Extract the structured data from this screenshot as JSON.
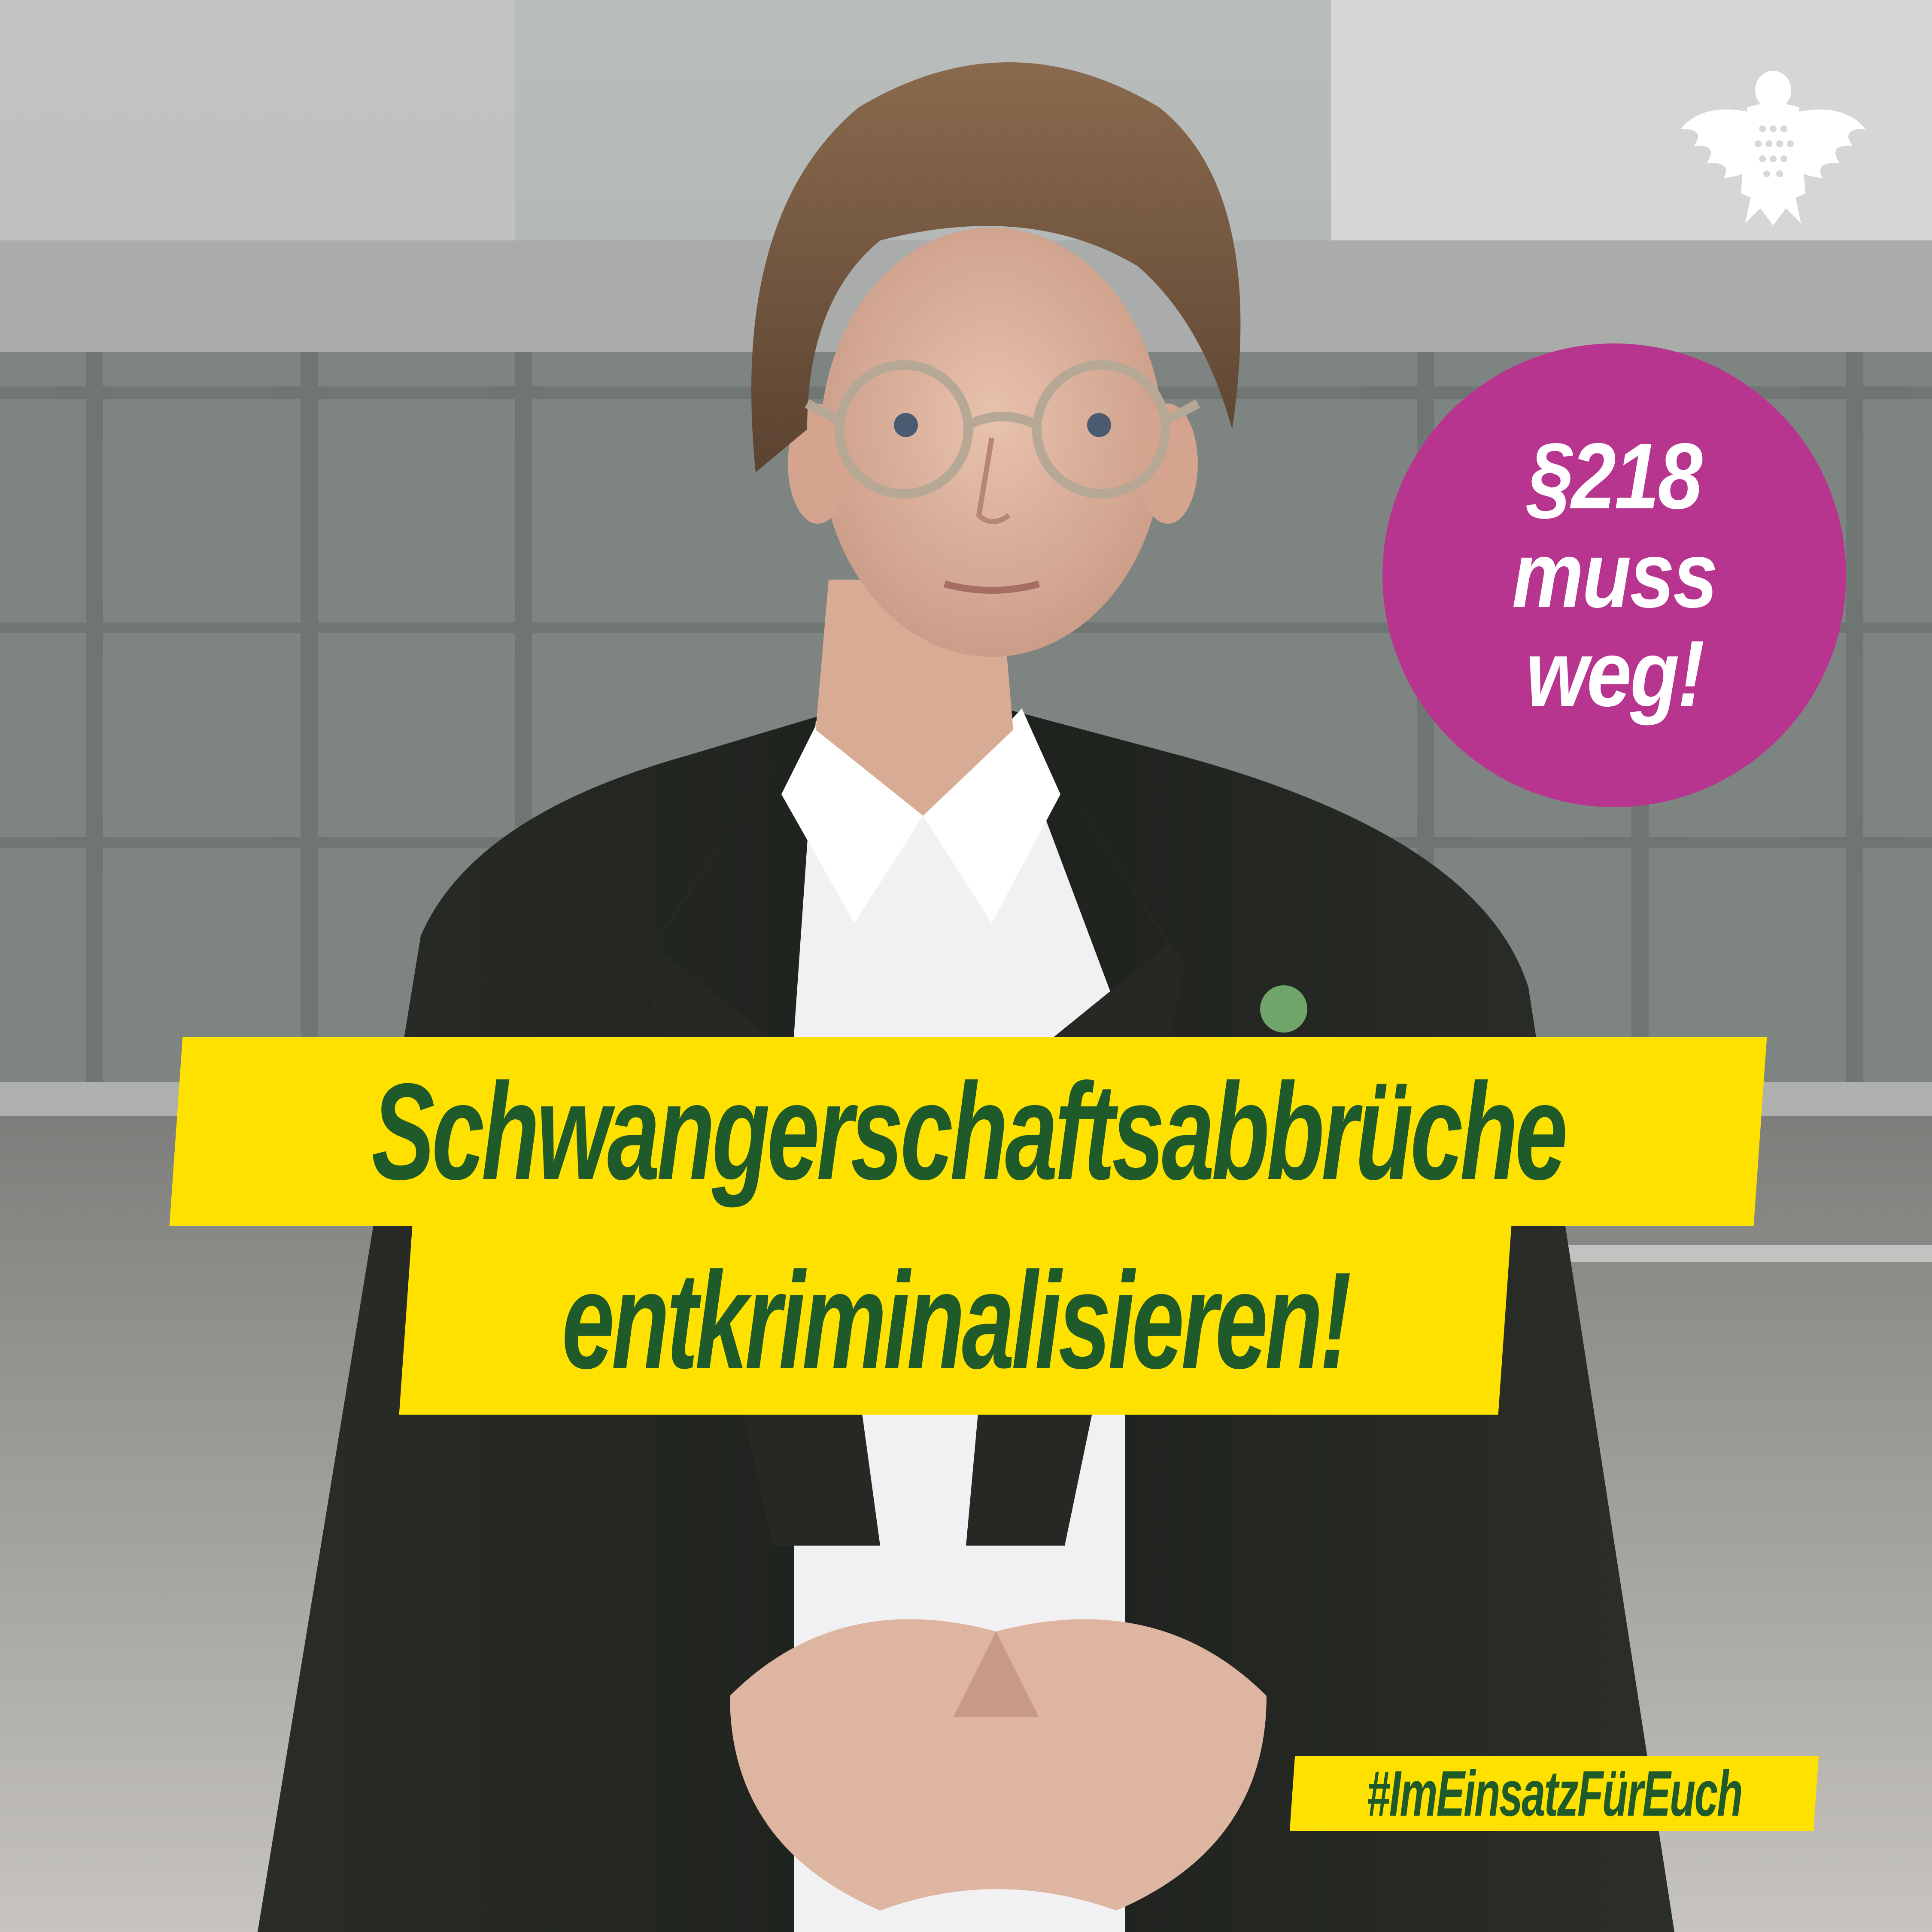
{
  "badge": {
    "line1": "§218",
    "line2": "muss",
    "line3": "weg!"
  },
  "headline": {
    "line1": "Schwangerschaftsabbrüche",
    "line2": "entkriminalisieren!"
  },
  "hashtag": "#ImEinsatzFürEuch",
  "logo": "bundestag-eagle-icon",
  "colors": {
    "badge_fill": "#b8358f",
    "banner_fill": "#ffe100",
    "banner_text": "#1f5a2a",
    "white": "#ffffff"
  }
}
